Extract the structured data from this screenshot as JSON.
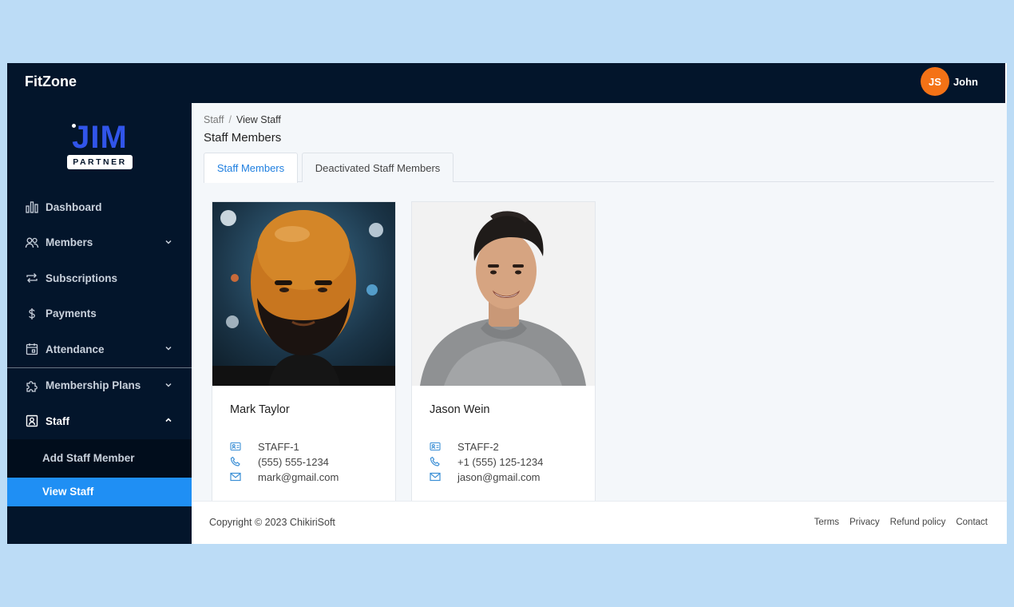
{
  "topbar": {
    "brand": "FitZone",
    "user_initials": "JS",
    "user_name": "John"
  },
  "logo": {
    "line1": "JIM",
    "line2": "PARTNER"
  },
  "sidebar": {
    "items": [
      {
        "label": "Dashboard",
        "icon": "bar-chart-icon"
      },
      {
        "label": "Members",
        "icon": "users-icon"
      },
      {
        "label": "Subscriptions",
        "icon": "repeat-icon"
      },
      {
        "label": "Payments",
        "icon": "dollar-icon"
      },
      {
        "label": "Attendance",
        "icon": "calendar-icon"
      },
      {
        "label": "Membership Plans",
        "icon": "puzzle-icon"
      },
      {
        "label": "Staff",
        "icon": "id-badge-icon"
      }
    ],
    "sub_items": [
      {
        "label": "Add Staff Member"
      },
      {
        "label": "View Staff"
      }
    ]
  },
  "breadcrumb": {
    "parent": "Staff",
    "separator": "/",
    "current": "View Staff"
  },
  "page_title": "Staff Members",
  "tabs": [
    {
      "label": "Staff Members"
    },
    {
      "label": "Deactivated Staff Members"
    }
  ],
  "staff": [
    {
      "name": "Mark Taylor",
      "id": "STAFF-1",
      "phone": "(555) 555-1234",
      "email": "mark@gmail.com"
    },
    {
      "name": "Jason Wein",
      "id": "STAFF-2",
      "phone": "+1 (555) 125-1234",
      "email": "jason@gmail.com"
    }
  ],
  "footer": {
    "copyright": "Copyright © 2023 ChikiriSoft",
    "links": [
      "Terms",
      "Privacy",
      "Refund policy",
      "Contact"
    ]
  },
  "colors": {
    "nav_bg": "#03152b",
    "accent": "#1f8ff4",
    "avatar": "#f47216",
    "logo_blue": "#3155ea",
    "page_bg": "#bcdcf6"
  }
}
